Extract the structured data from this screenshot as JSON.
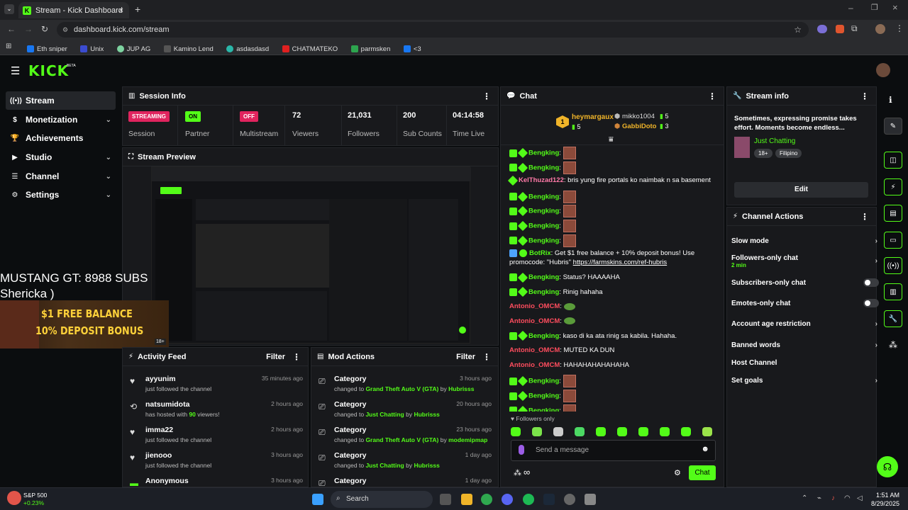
{
  "browser": {
    "tab_title": "Stream - Kick Dashboard",
    "url": "dashboard.kick.com/stream",
    "bookmarks": [
      "Eth sniper",
      "Unix",
      "JUP AG",
      "Kamino Lend",
      "asdasdasd",
      "CHATMATEKO",
      "parmsken",
      "<3"
    ]
  },
  "app": {
    "logo": "KICK",
    "beta": "BETA"
  },
  "sidebar": {
    "items": [
      {
        "label": "Stream",
        "icon": "((•))"
      },
      {
        "label": "Monetization",
        "icon": "$"
      },
      {
        "label": "Achievements",
        "icon": "🏆"
      },
      {
        "label": "Studio",
        "icon": "▶"
      },
      {
        "label": "Channel",
        "icon": "☰"
      },
      {
        "label": "Settings",
        "icon": "⚙"
      }
    ]
  },
  "session": {
    "title": "Session Info",
    "streaming_badge": "STREAMING",
    "session_label": "Session",
    "on_badge": "ON",
    "partner_label": "Partner Income",
    "off_badge": "OFF",
    "multistream_label": "Multistream",
    "viewers": "72",
    "viewers_label": "Viewers",
    "followers": "21,031",
    "followers_label": "Followers",
    "subs": "200",
    "subs_label": "Sub Counts",
    "time": "04:14:58",
    "time_label": "Time Live"
  },
  "preview": {
    "title": "Stream Preview",
    "overlay_line1": "MUSTANG GT: 8988 SUBS",
    "overlay_line2": "Shericka )",
    "banner_line1": "$1 FREE BALANCE",
    "banner_line2": "10% DEPOSIT BONUS",
    "age": "18+"
  },
  "activity": {
    "title": "Activity Feed",
    "filter": "Filter",
    "rows": [
      {
        "name": "ayyunim",
        "sub": "just followed the channel",
        "time": "35 minutes ago"
      },
      {
        "name": "natsumidota",
        "sub_pre": "has hosted with ",
        "sub_num": "90",
        "sub_post": " viewers!",
        "time": "2 hours ago"
      },
      {
        "name": "imma22",
        "sub": "just followed the channel",
        "time": "2 hours ago"
      },
      {
        "name": "jienooo",
        "sub": "just followed the channel",
        "time": "3 hours ago"
      },
      {
        "name": "Anonymous",
        "sub": "",
        "time": "3 hours ago"
      }
    ]
  },
  "mod": {
    "title": "Mod Actions",
    "filter": "Filter",
    "rows": [
      {
        "name": "Category",
        "pre": "changed to ",
        "cat": "Grand Theft Auto V (GTA)",
        "by": " by ",
        "user": "Hubrisss",
        "time": "3 hours ago"
      },
      {
        "name": "Category",
        "pre": "changed to ",
        "cat": "Just Chatting",
        "by": " by ",
        "user": "Hubrisss",
        "time": "20 hours ago"
      },
      {
        "name": "Category",
        "pre": "changed to ",
        "cat": "Grand Theft Auto V (GTA)",
        "by": " by ",
        "user": "modemipmap",
        "time": "23 hours ago"
      },
      {
        "name": "Category",
        "pre": "changed to ",
        "cat": "Just Chatting",
        "by": " by ",
        "user": "Hubrisss",
        "time": "1 day ago"
      },
      {
        "name": "Category",
        "pre": "",
        "cat": "",
        "by": "",
        "user": "",
        "time": "1 day ago"
      }
    ]
  },
  "chat": {
    "title": "Chat",
    "top1": {
      "name": "heymargaux",
      "count": "5"
    },
    "top2": {
      "name": "mikko1004",
      "count": "5"
    },
    "top3": {
      "name": "GabbiDoto",
      "count": "3"
    },
    "messages": [
      {
        "user": "Bengking",
        "text": "",
        "type": "emote"
      },
      {
        "user": "Bengking",
        "text": "",
        "type": "emote"
      },
      {
        "user": "KelThuzad122",
        "text": "bris yung fire portals ko naimbak n sa basement",
        "type": "pink"
      },
      {
        "user": "Bengking",
        "text": "",
        "type": "emote"
      },
      {
        "user": "Bengking",
        "text": "",
        "type": "emote"
      },
      {
        "user": "Bengking",
        "text": "",
        "type": "emote"
      },
      {
        "user": "Bengking",
        "text": "",
        "type": "emote"
      },
      {
        "user": "BotRix",
        "text": "Get $1 free balance + 10% deposit bonus! Use promocode: \"Hubris\"",
        "link": "https://farmskins.com/ref-hubris",
        "type": "bot"
      },
      {
        "user": "Bengking",
        "text": "Status? HAAAAHA",
        "type": "text"
      },
      {
        "user": "Bengking",
        "text": "Rinig hahaha",
        "type": "text"
      },
      {
        "user": "Antonio_OMCM",
        "text": "",
        "type": "frog"
      },
      {
        "user": "Antonio_OMCM",
        "text": "",
        "type": "frog"
      },
      {
        "user": "Bengking",
        "text": "kaso di ka ata rinig sa kabila. Hahaha.",
        "type": "text"
      },
      {
        "user": "Antonio_OMCM",
        "text": "MUTED KA DUN",
        "type": "red"
      },
      {
        "user": "Antonio_OMCM",
        "text": "HAHAHAHAHAHAHA",
        "type": "red"
      },
      {
        "user": "Bengking",
        "text": "",
        "type": "emote"
      },
      {
        "user": "Bengking",
        "text": "",
        "type": "emote"
      },
      {
        "user": "Bengking",
        "text": "",
        "type": "emote"
      }
    ],
    "followers_only": "Followers only",
    "placeholder": "Send a message",
    "send": "Chat"
  },
  "stream_info": {
    "title": "Stream info",
    "description": "Sometimes, expressing promise takes effort. Moments become endless...",
    "category": "Just Chatting",
    "tags": [
      "18+",
      "Filipino"
    ],
    "edit": "Edit"
  },
  "channel_actions": {
    "title": "Channel Actions",
    "items": [
      {
        "label": "Slow mode",
        "kind": "chev"
      },
      {
        "label": "Followers-only chat",
        "sub": "2 min",
        "kind": "chev"
      },
      {
        "label": "Subscribers-only chat",
        "kind": "toggle"
      },
      {
        "label": "Emotes-only chat",
        "kind": "toggle"
      },
      {
        "label": "Account age restriction",
        "kind": "chev"
      },
      {
        "label": "Banned words",
        "kind": "chev"
      },
      {
        "label": "Host Channel",
        "kind": "none"
      },
      {
        "label": "Set goals",
        "kind": "chev"
      }
    ]
  },
  "taskbar": {
    "ticker": "S&P 500",
    "change": "+0.23%",
    "search": "Search",
    "time": "1:51 AM",
    "date": "8/29/2025"
  },
  "colors": {
    "brand": "#53fc18",
    "red": "#ff4d5e",
    "panel": "#18191c"
  }
}
